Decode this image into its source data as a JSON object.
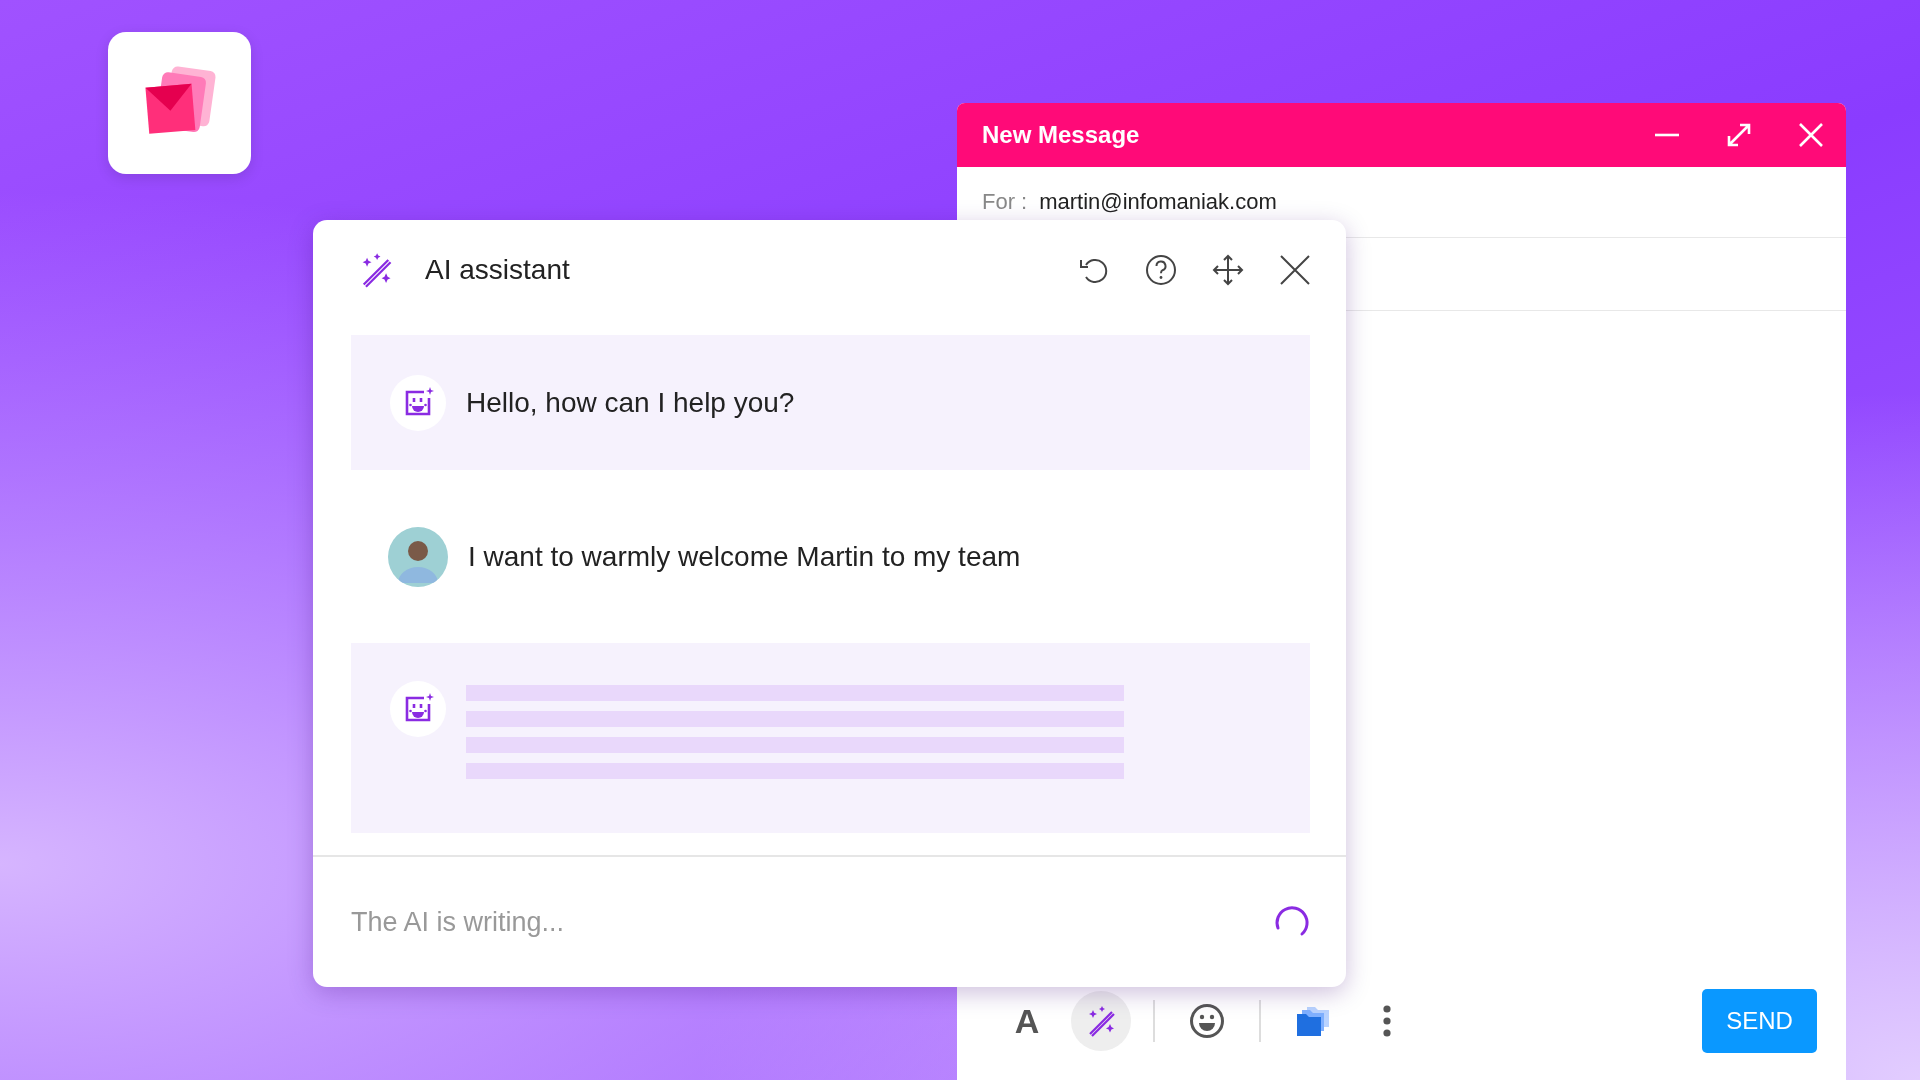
{
  "compose": {
    "title": "New Message",
    "for_label": "For :",
    "recipient": "martin@infomaniak.com",
    "toolbar": [
      {
        "kind": "format",
        "label": "A",
        "selected": false
      },
      {
        "kind": "ai",
        "selected": true
      },
      {
        "kind": "separator"
      },
      {
        "kind": "emoji",
        "selected": false
      },
      {
        "kind": "separator"
      },
      {
        "kind": "folder",
        "selected": false
      },
      {
        "kind": "more",
        "selected": false
      }
    ],
    "send": "SEND"
  },
  "assistant": {
    "title": "AI assistant",
    "header_buttons": [
      {
        "kind": "undo"
      },
      {
        "kind": "help"
      },
      {
        "kind": "move"
      },
      {
        "kind": "close"
      }
    ],
    "messages": [
      {
        "kind": "bot",
        "text": "Hello, how can I help you?"
      },
      {
        "kind": "user",
        "text": "I want to warmly welcome Martin to my team"
      },
      {
        "kind": "pending"
      }
    ],
    "input": {
      "placeholder": "The AI is writing...",
      "loading": true
    }
  }
}
